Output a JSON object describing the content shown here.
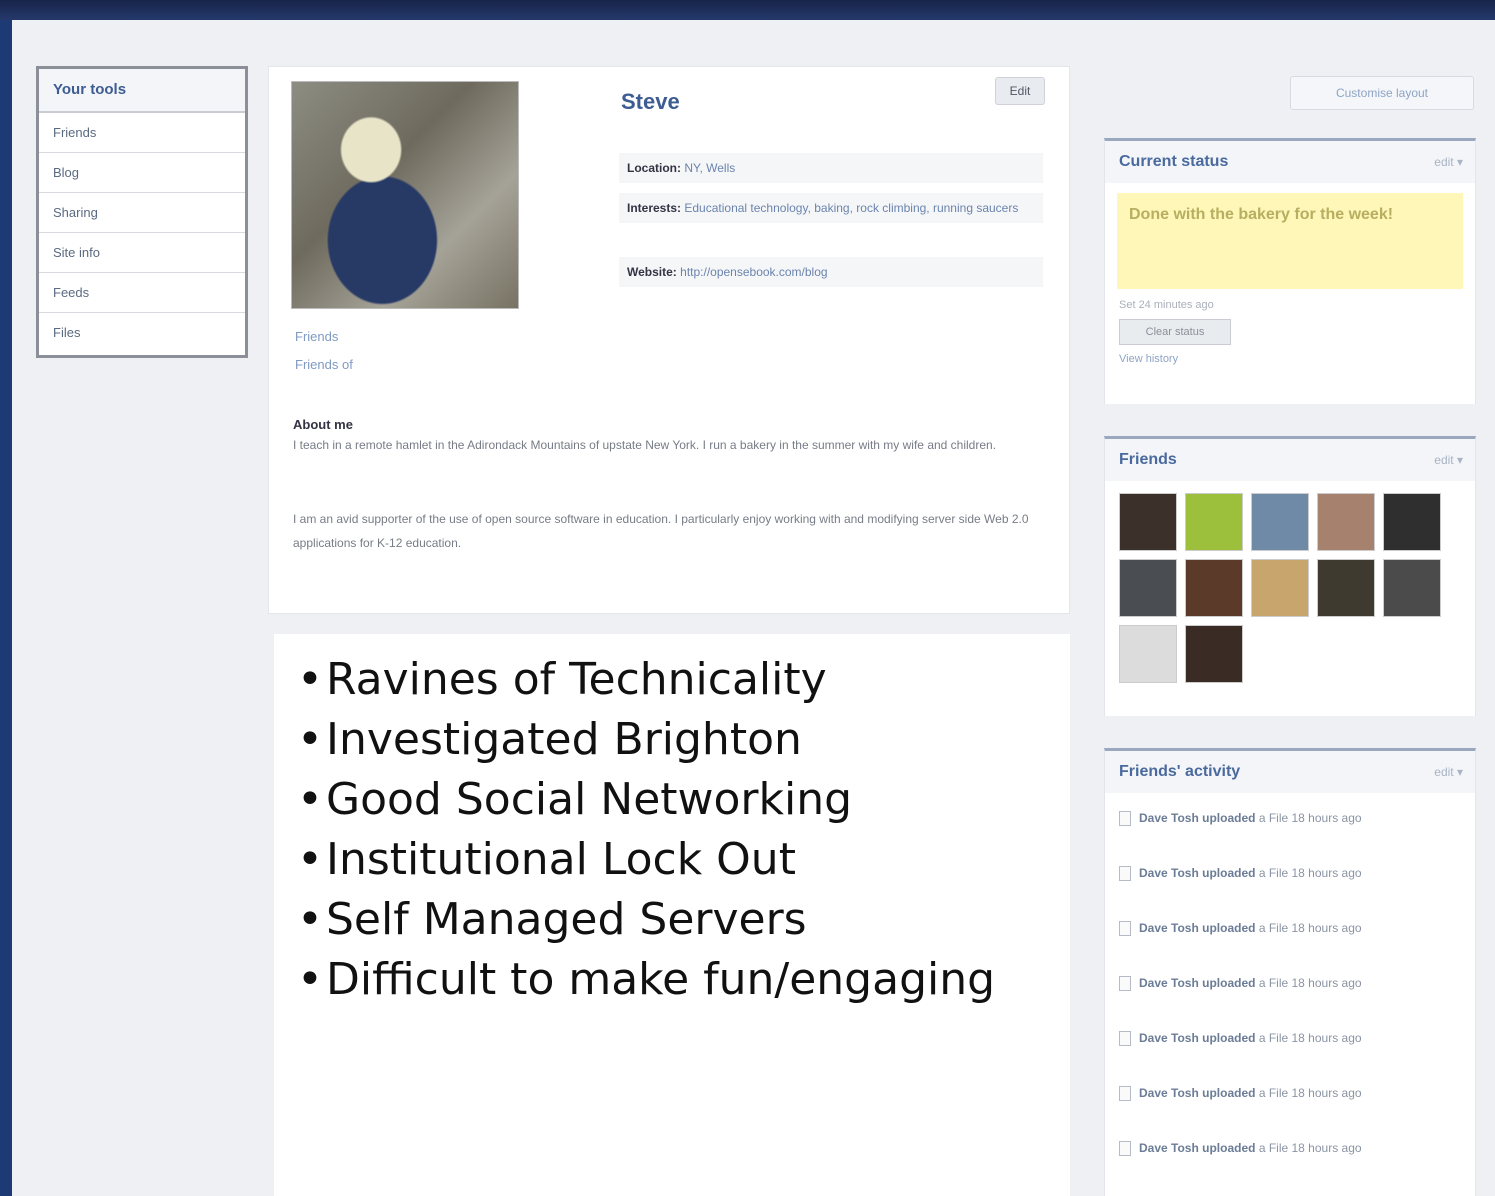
{
  "tools": {
    "title": "Your tools",
    "items": [
      "Friends",
      "Blog",
      "Sharing",
      "Site info",
      "Feeds",
      "Files"
    ]
  },
  "profile": {
    "name": "Steve",
    "edit_label": "Edit",
    "friends_link": "Friends",
    "friends_of_link": "Friends of",
    "location_label": "Location:",
    "location_value": "NY, Wells",
    "interests_label": "Interests:",
    "interests_value": "Educational technology, baking, rock climbing, running saucers",
    "website_label": "Website:",
    "website_value": "http://opensebook.com/blog",
    "about_title": "About me",
    "about_p1": "I teach in a remote hamlet in the Adirondack Mountains of upstate New York. I run a bakery in the summer with my wife and children.",
    "about_p2": "I am an avid supporter of the use of open source software in education. I particularly enjoy working with and modifying server side Web 2.0 applications for K-12 education."
  },
  "bullets": [
    "Ravines of Technicality",
    "Investigated Brighton",
    "Good Social Networking",
    "Institutional Lock Out",
    "Self Managed Servers",
    "Difficult to make fun/engaging"
  ],
  "sidebar": {
    "customize_label": "Customise layout",
    "status": {
      "title": "Current status",
      "edit": "edit",
      "text": "Done with the bakery for the week!",
      "meta": "Set 24 minutes ago",
      "button": "Clear status",
      "history_link": "View history"
    },
    "friends": {
      "title": "Friends",
      "edit": "edit",
      "thumbs": [
        "#3b302a",
        "#9cbf3c",
        "#6f8aa6",
        "#a6826e",
        "#2f2f2f",
        "#4a4e52",
        "#5b3a2a",
        "#c9a56e",
        "#3e3a30",
        "#4b4b4b",
        "#dcdcdc",
        "#3a2c24"
      ]
    },
    "activity": {
      "title": "Friends' activity",
      "edit": "edit",
      "rows": [
        {
          "who": "Dave Tosh uploaded",
          "what": "a File 18 hours ago"
        },
        {
          "who": "Dave Tosh uploaded",
          "what": "a File 18 hours ago"
        },
        {
          "who": "Dave Tosh uploaded",
          "what": "a File 18 hours ago"
        },
        {
          "who": "Dave Tosh uploaded",
          "what": "a File 18 hours ago"
        },
        {
          "who": "Dave Tosh uploaded",
          "what": "a File 18 hours ago"
        },
        {
          "who": "Dave Tosh uploaded",
          "what": "a File 18 hours ago"
        },
        {
          "who": "Dave Tosh uploaded",
          "what": "a File 18 hours ago"
        }
      ]
    }
  }
}
